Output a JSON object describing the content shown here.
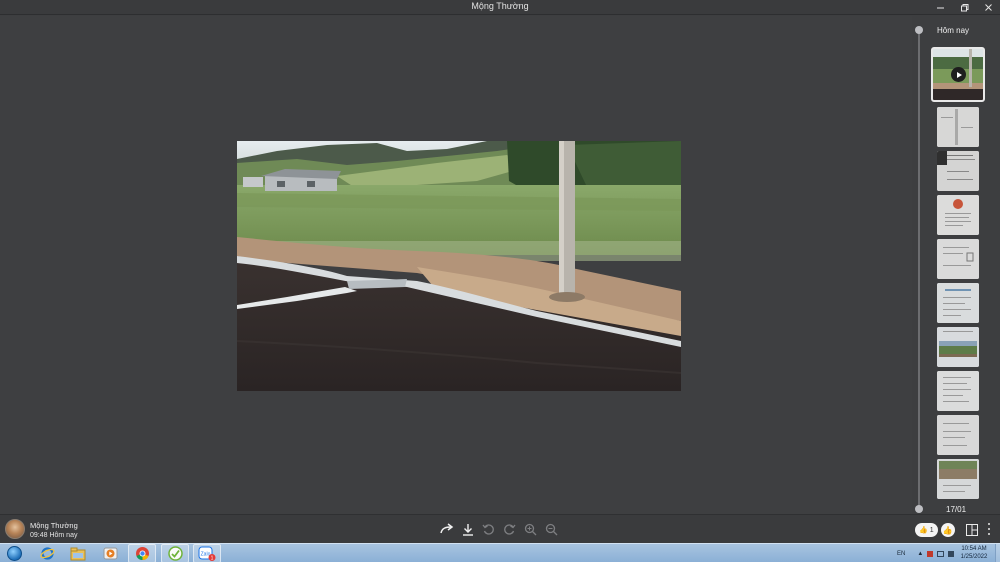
{
  "window": {
    "title": "Mộng Thường",
    "controls": [
      "minimize",
      "restore",
      "close"
    ]
  },
  "timeline": {
    "top_label": "Hôm nay",
    "bottom_label": "17/01",
    "thumbnails": [
      {
        "kind": "video",
        "active": true
      },
      {
        "kind": "document"
      },
      {
        "kind": "document"
      },
      {
        "kind": "document"
      },
      {
        "kind": "document"
      },
      {
        "kind": "document"
      },
      {
        "kind": "photo"
      },
      {
        "kind": "document"
      },
      {
        "kind": "document"
      },
      {
        "kind": "photo"
      }
    ]
  },
  "footer": {
    "sender_name": "Mộng Thường",
    "sent_time": "09:48 Hôm nay",
    "tools": [
      "share-icon",
      "download-icon",
      "rotate-left-icon",
      "rotate-right-icon",
      "zoom-in-icon",
      "zoom-out-icon"
    ],
    "reaction_count": "1"
  },
  "taskbar": {
    "apps": [
      "internet-explorer",
      "file-explorer",
      "media-player",
      "chrome",
      "green-app",
      "zalo"
    ],
    "zalo_badge": "1",
    "language": "EN",
    "time": "10:54 AM",
    "date": "1/25/2022"
  },
  "colors": {
    "background": "#3e3f41",
    "taskbar": "#9dbcdc"
  }
}
